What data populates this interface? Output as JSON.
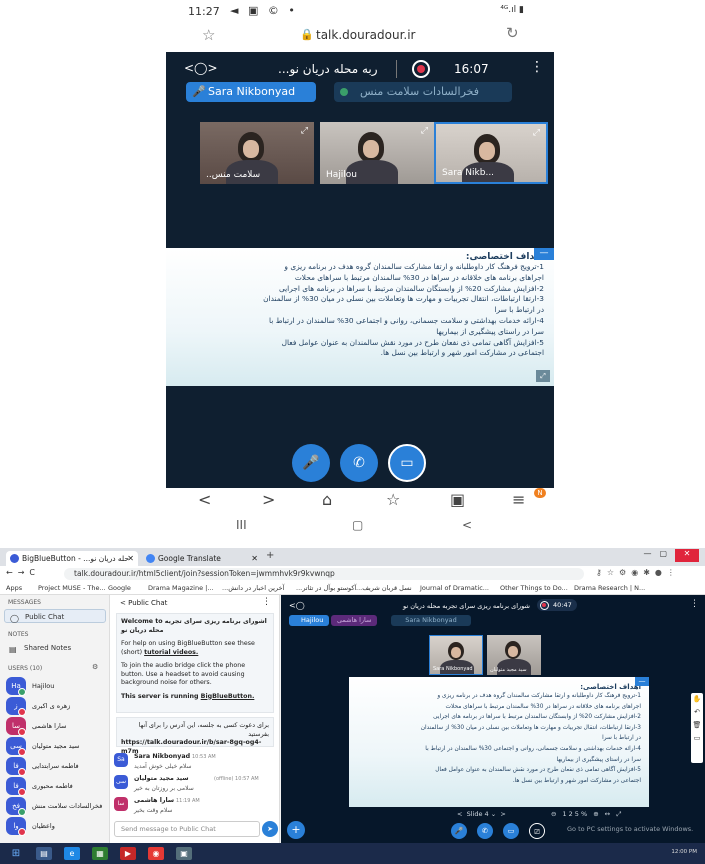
{
  "phone": {
    "status": {
      "time": "11:27",
      "icons": "◄ ▣ © •",
      "right": "⁴ᴳ.ıl ▮"
    },
    "browser": {
      "url": "talk.douradour.ir"
    },
    "meeting": {
      "title": "...ربه محله دریان نو",
      "timer": "16:07",
      "talkers": [
        "Sara Nikbonyad",
        "فخرالسادات سلامت منس"
      ],
      "videos": [
        {
          "label": "..سلامت منس"
        },
        {
          "label": "Hajilou"
        },
        {
          "label": "Sara Nikb..."
        }
      ],
      "slide": {
        "header": "اهداف اختصاصی:",
        "lines": [
          "1-ترویج فرهنگ کار داوطلبانه و ارتقا مشارکت سالمندان گروه هدف در برنامه ریزی و",
          "اجراهای برنامه های خلاقانه در سراها در 30% سالمندان مرتبط با سراهای محلات",
          "2-افزایش مشارکت 20% از  وابستگان سالمندان مرتبط با سراها در برنامه های اجرایی",
          "3-ارتقا ارتباطات، انتقال تجربیات و مهارت ها وتعاملات بین  نسلی در میان 30% از سالمندان",
          "در ارتباط با سرا",
          "4-ارائه خدمات بهداشتی و سلامت جسمانی، روانی و اجتماعی 30% سالمندان در ارتباط با",
          "سرا در راستای  پیشگیری از بیماریها",
          "5-افزایش آگاهی تمامی ذی نفعان طرح در مورد نقش سالمندان به عنوان عوامل فعال",
          "اجتماعی در مشارکت امور شهر و ارتباط بین نسل ها."
        ]
      }
    },
    "nav": {
      "badge": "N"
    }
  },
  "desktop": {
    "tabs": [
      {
        "label": "BigBlueButton - ...حله دریان نو",
        "color": "#3b5bd6"
      },
      {
        "label": "Google Translate",
        "color": "#4285f4"
      }
    ],
    "address": "talk.douradour.ir/html5client/join?sessionToken=jwmmhvk9r9kvwnqp",
    "bookmarks": [
      "Apps",
      "Project MUSE - The...",
      "Google",
      "Drama Magazine |...",
      "...آخرین اخبار در دانش",
      "...آکوستو بوآل در تئاتر",
      "...نسل قربان شریف",
      "Journal of Dramatic...",
      "Other Things to Do...",
      "Drama Research | N..."
    ],
    "sidebar": {
      "messages_title": "MESSAGES",
      "public_chat": "Public Chat",
      "notes_title": "NOTES",
      "shared_notes": "Shared Notes",
      "users_title": "USERS (10)",
      "users": [
        {
          "initials": "Ha",
          "name": "Hajilou",
          "color": "#3b5bd6",
          "status": "#3a9f6a"
        },
        {
          "initials": "ز",
          "name": "زهره ی اکبری",
          "color": "#3b5bd6",
          "status": "#e0354c"
        },
        {
          "initials": "سا",
          "name": "سارا هاشمی",
          "color": "#c0306a",
          "status": "#e0354c"
        },
        {
          "initials": "سی",
          "name": "سید مجید متولیان",
          "color": "#3b5bd6",
          "status": "#e0354c"
        },
        {
          "initials": "فا",
          "name": "فاطمه سرابتدایی",
          "color": "#3b5bd6",
          "status": "#e0354c"
        },
        {
          "initials": "فا",
          "name": "فاطمه محبوری",
          "color": "#3b5bd6",
          "status": "#e0354c"
        },
        {
          "initials": "فخ",
          "name": "فخرالسادات سلامت منش",
          "color": "#3b5bd6",
          "status": "#3a9f6a"
        },
        {
          "initials": "وا",
          "name": "واعظیان",
          "color": "#3b5bd6",
          "status": "#e0354c"
        }
      ]
    },
    "chat": {
      "header": "Public Chat",
      "welcome_title": "Welcome to اشورای برنامه ریزی سرای تجربه محله دریان نو",
      "help_pre": "For help on using BigBlueButton see these (short) ",
      "help_link": "tutorial videos.",
      "audio": "To join the audio bridge click the phone button. Use a headset to avoid causing background noise for others.",
      "running_pre": "This server is running ",
      "running_link": "BigBlueButton.",
      "notice_fa": "برای دعوت کسی به جلسه، این آدرس را برای آنها بفرستید",
      "notice_url": "https://talk.douradour.ir/b/sar-8gq-og4-m7m",
      "messages": [
        {
          "initials": "Sa",
          "name": "Sara Nikbonyad",
          "time": "10:53 AM",
          "text": "سلام خیلی خوش آمدید",
          "color": "#3b5bd6"
        },
        {
          "initials": "سی",
          "name": "سید مجید متولیان",
          "time": "(offline) 10:57 AM",
          "text": "سلامی بر روزتان به خیر",
          "color": "#3b5bd6"
        },
        {
          "initials": "سا",
          "name": "سارا هاشمی",
          "time": "11:19 AM",
          "text": "سلام وقت بخیر",
          "color": "#c0306a"
        }
      ],
      "input_placeholder": "Send message to Public Chat"
    },
    "presentation": {
      "title": "شورای برنامه ریزی سرای تجربه محله دریان نو",
      "timer": "40:47",
      "talkers": [
        "Hajilou",
        "سارا هاشمی",
        "Sara Nikbonyad"
      ],
      "videos": [
        {
          "label": "Sara Nikbonyad"
        },
        {
          "label": "سید مجید متولیان"
        }
      ],
      "slide_status": "Slide 4",
      "zoom": "125%",
      "watermark": "Go to PC settings to activate Windows."
    },
    "taskbar": {
      "tray": "12:00 PM"
    }
  }
}
